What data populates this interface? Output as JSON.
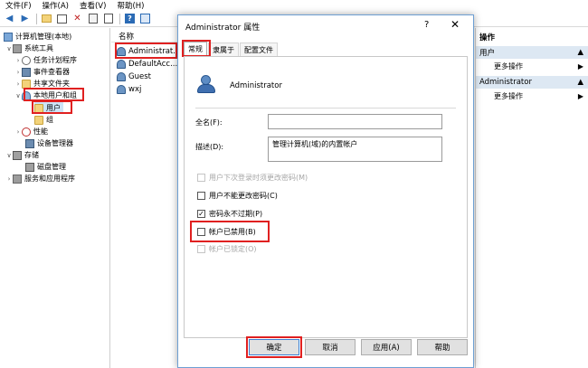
{
  "menu": [
    "文件(F)",
    "操作(A)",
    "查看(V)",
    "帮助(H)"
  ],
  "toolbar": {
    "back_icon": "arrow-left",
    "forward_icon": "arrow-right",
    "help_icon": "?"
  },
  "tree": {
    "root": "计算机管理(本地)",
    "system_tools": "系统工具",
    "task_scheduler": "任务计划程序",
    "event_viewer": "事件查看器",
    "shared_folders": "共享文件夹",
    "local_users": "本地用户和组",
    "users": "用户",
    "groups": "组",
    "performance": "性能",
    "device_manager": "设备管理器",
    "storage": "存储",
    "disk_mgmt": "磁盘管理",
    "services": "服务和应用程序"
  },
  "list": {
    "header": "名称",
    "rows": [
      "Administrat...",
      "DefaultAcc...",
      "Guest",
      "wxj"
    ]
  },
  "actions": {
    "title": "操作",
    "section1": "用户",
    "section1_item": "更多操作",
    "section2": "Administrator",
    "section2_item": "更多操作"
  },
  "dialog": {
    "title": "Administrator 属性",
    "help": "?",
    "close": "✕",
    "tabs": [
      "常规",
      "隶属于",
      "配置文件"
    ],
    "username": "Administrator",
    "fullname_label": "全名(F):",
    "fullname_value": "",
    "desc_label": "描述(D):",
    "desc_value": "管理计算机(域)的内置帐户",
    "cb1": "用户下次登录时须更改密码(M)",
    "cb2": "用户不能更改密码(C)",
    "cb3": "密码永不过期(P)",
    "cb4": "帐户已禁用(B)",
    "cb5": "帐户已锁定(O)",
    "ok": "确定",
    "cancel": "取消",
    "apply": "应用(A)",
    "helpbtn": "帮助"
  }
}
